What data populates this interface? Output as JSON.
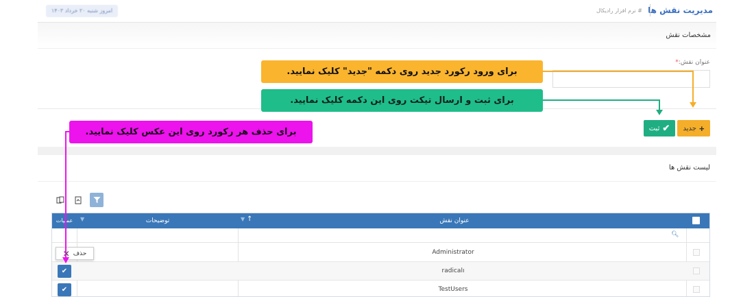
{
  "header": {
    "title": "مدیریت نقش ها",
    "subtitle": "# نرم افزار رادیکال",
    "date_chip": "امروز شنبه ۲۰ خرداد ۱۴۰۳"
  },
  "form": {
    "section_title": "مشخصات نقش",
    "role_title_label": "عنوان نقش:",
    "required_mark": "*",
    "role_title_value": ""
  },
  "buttons": {
    "new_label": "جدید",
    "save_label": "ثبت"
  },
  "list": {
    "section_title": "لیست نقش ها",
    "columns": {
      "role_title": "عنوان نقش",
      "description": "توضیحات",
      "operations": "عملیات"
    },
    "rows": [
      {
        "name": "Administrator"
      },
      {
        "name": "radicalı"
      },
      {
        "name": "TestUsers"
      }
    ],
    "tooltip_delete": "حذف"
  },
  "callouts": {
    "new_hint": "برای ورود رکورد جدید روی دکمه \"جدید\" کلیک نمایید.",
    "save_hint": "برای ثبت و ارسال تیکت روی این دکمه کلیک نمایید.",
    "delete_hint": "برای حذف هر رکورد روی این عکس کلیک نمایید."
  },
  "colors": {
    "primary": "#3a77b8",
    "new_button": "#f5ae2a",
    "save_button": "#1fae82",
    "callout_yellow": "#fbb42e",
    "callout_green": "#1fbd8a",
    "callout_pink": "#ec13ec"
  }
}
